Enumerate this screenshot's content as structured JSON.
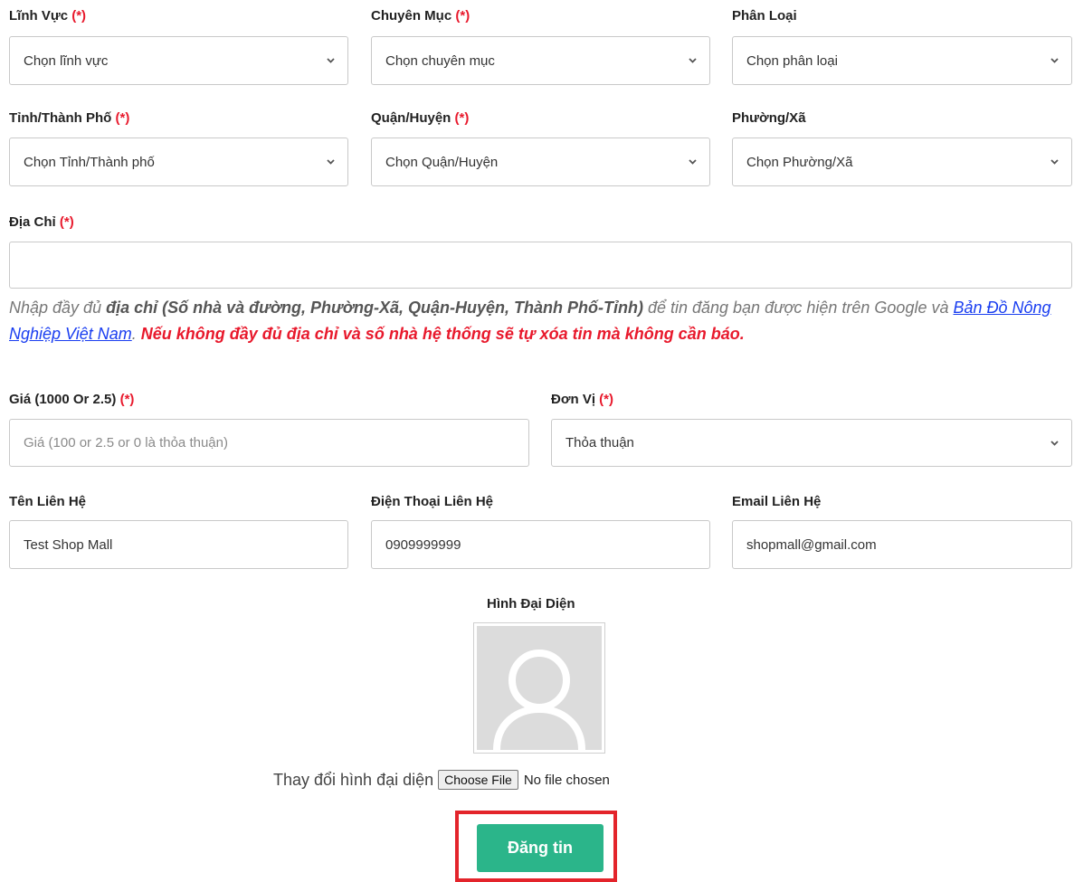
{
  "row1": {
    "linh_vuc": {
      "label": "Lĩnh Vực",
      "required": "(*)",
      "value": "Chọn lĩnh vực"
    },
    "chuyen_muc": {
      "label": "Chuyên Mục",
      "required": "(*)",
      "value": "Chọn chuyên mục"
    },
    "phan_loai": {
      "label": "Phân Loại",
      "value": "Chọn phân loại"
    }
  },
  "row2": {
    "tinh": {
      "label": "Tỉnh/Thành Phố",
      "required": "(*)",
      "value": "Chọn Tỉnh/Thành phố"
    },
    "quan": {
      "label": "Quận/Huyện",
      "required": "(*)",
      "value": "Chọn Quận/Huyện"
    },
    "phuong": {
      "label": "Phường/Xã",
      "value": "Chọn Phường/Xã"
    }
  },
  "address": {
    "label": "Địa Chỉ",
    "required": "(*)",
    "value": "",
    "hint_1": "Nhập đầy đủ ",
    "hint_bold": "địa chỉ (Số nhà và đường, Phường-Xã, Quận-Huyện, Thành Phố-Tỉnh)",
    "hint_2": " để tin đăng bạn được hiện trên Google và ",
    "hint_link": "Bản Đồ Nông Nghiệp Việt Nam",
    "hint_3": ". ",
    "hint_warning": "Nếu không đầy đủ địa chỉ và số nhà hệ thống sẽ tự xóa tin mà không cần báo."
  },
  "price": {
    "label": "Giá (1000 Or 2.5)",
    "required": "(*)",
    "placeholder": "Giá (100 or 2.5 or 0 là thỏa thuận)"
  },
  "unit": {
    "label": "Đơn Vị",
    "required": "(*)",
    "value": "Thỏa thuận"
  },
  "contact": {
    "name": {
      "label": "Tên Liên Hệ",
      "value": "Test Shop Mall"
    },
    "phone": {
      "label": "Điện Thoại Liên Hệ",
      "value": "0909999999"
    },
    "email": {
      "label": "Email Liên Hệ",
      "value": "shopmall@gmail.com"
    }
  },
  "avatar": {
    "title": "Hình Đại Diện",
    "change_label": "Thay đổi hình đại diện",
    "choose_button": "Choose File",
    "file_status": "No file chosen"
  },
  "submit_label": "Đăng tin",
  "colors": {
    "accent": "#2bb58a",
    "required": "#e8192c",
    "link": "#1a3ef0",
    "highlight": "#e3242b"
  }
}
